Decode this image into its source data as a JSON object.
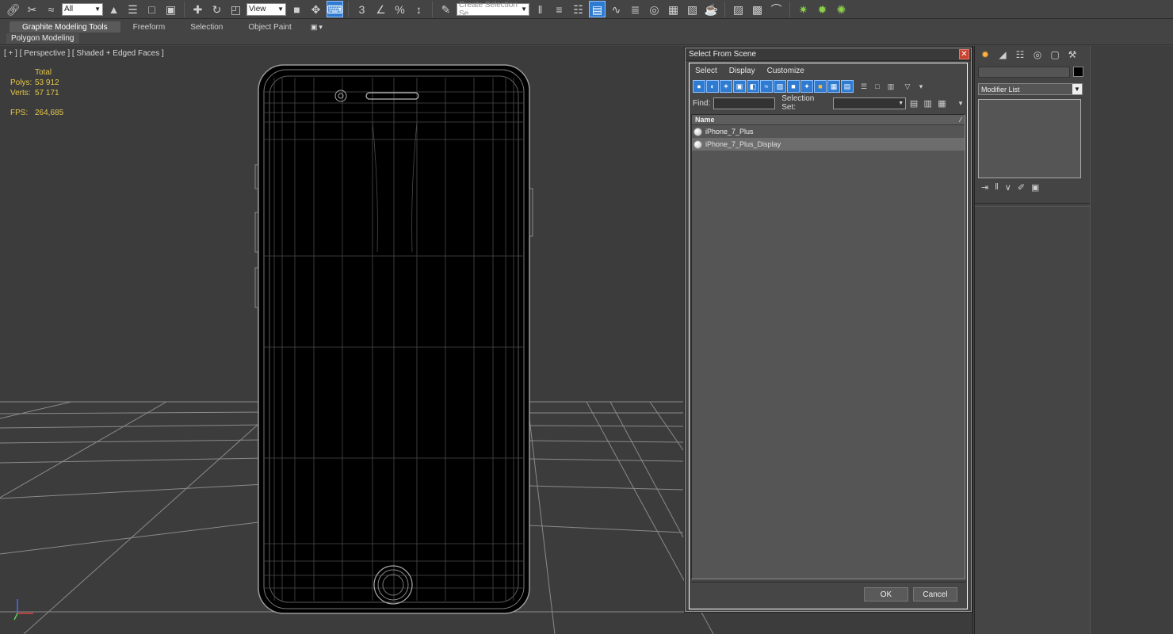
{
  "toolbar": {
    "selection_filter": "All",
    "reference_coord": "View",
    "snap_label": "3",
    "named_selection_placeholder": "Create Selection Se"
  },
  "ribbon": {
    "tabs": [
      "Graphite Modeling Tools",
      "Freeform",
      "Selection",
      "Object Paint"
    ],
    "sub_label": "Polygon Modeling"
  },
  "viewport": {
    "label": "[ + ] [ Perspective ] [ Shaded + Edged Faces ]",
    "stats": {
      "header": "Total",
      "polys_label": "Polys:",
      "polys_value": "53 912",
      "verts_label": "Verts:",
      "verts_value": "57 171",
      "fps_label": "FPS:",
      "fps_value": "264,685"
    }
  },
  "dialog": {
    "title": "Select From Scene",
    "menu": [
      "Select",
      "Display",
      "Customize"
    ],
    "find_label": "Find:",
    "selection_set_label": "Selection Set:",
    "column_header": "Name",
    "objects": [
      {
        "name": "iPhone_7_Plus",
        "selected": false
      },
      {
        "name": "iPhone_7_Plus_Display",
        "selected": true
      }
    ],
    "ok_label": "OK",
    "cancel_label": "Cancel"
  },
  "command_panel": {
    "modifier_list": "Modifier List",
    "object_color": "#000000"
  },
  "colors": {
    "accent_blue": "#2e7bd1",
    "stats_yellow": "#e3c74a",
    "close_red": "#c9412f"
  }
}
